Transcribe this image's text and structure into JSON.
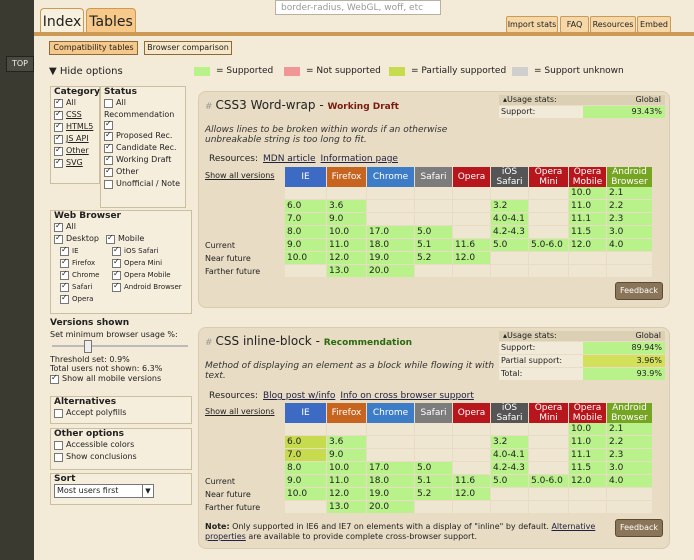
{
  "top_button": "TOP",
  "search": {
    "placeholder": "border-radius, WebGL, woff, etc"
  },
  "tabs": {
    "index": "Index",
    "tables": "Tables"
  },
  "top_nav": [
    "Import stats",
    "FAQ",
    "Resources",
    "Embed"
  ],
  "modes": {
    "compat": "Compatibility tables",
    "compare": "Browser comparison"
  },
  "hide_options": "Hide options",
  "legend": [
    {
      "label": "= Supported",
      "color": "#b9f28a"
    },
    {
      "label": "= Not supported",
      "color": "#f09696"
    },
    {
      "label": "= Partially supported",
      "color": "#c6dc4e"
    },
    {
      "label": "= Support unknown",
      "color": "#cfcfcf"
    }
  ],
  "sidebar": {
    "category_title": "Category",
    "categories": [
      {
        "label": "All",
        "checked": true,
        "link": false
      },
      {
        "label": "CSS",
        "checked": true,
        "link": true
      },
      {
        "label": "HTML5",
        "checked": true,
        "link": true
      },
      {
        "label": "JS API",
        "checked": true,
        "link": true
      },
      {
        "label": "Other",
        "checked": true,
        "link": true
      },
      {
        "label": "SVG",
        "checked": true,
        "link": true
      }
    ],
    "status_title": "Status",
    "statuses": [
      {
        "label": "All",
        "checked": false
      },
      {
        "label": "",
        "checked": true
      },
      {
        "label": "Proposed Rec.",
        "checked": true
      },
      {
        "label": "Candidate Rec.",
        "checked": true
      },
      {
        "label": "Working Draft",
        "checked": true
      },
      {
        "label": "Other",
        "checked": true
      },
      {
        "label": "Unofficial / Note",
        "checked": false
      }
    ],
    "status_extra": "Recommendation",
    "web_browser_title": "Web Browser",
    "wb_all": "All",
    "desktop": "Desktop",
    "mobile": "Mobile",
    "desktop_browsers": [
      "IE",
      "Firefox",
      "Chrome",
      "Safari",
      "Opera"
    ],
    "mobile_browsers": [
      "iOS Safari",
      "Opera Mini",
      "Opera Mobile",
      "Android Browser"
    ],
    "versions_title": "Versions shown",
    "min_usage_label": "Set minimum browser usage %:",
    "threshold": "Threshold set: 0.9%",
    "total_users": "Total users not shown: 6.3%",
    "show_mobile": "Show all mobile versions",
    "alternatives_title": "Alternatives",
    "accept_polyfills": "Accept polyfills",
    "other_title": "Other options",
    "accessible_colors": "Accessible colors",
    "show_conclusions": "Show conclusions",
    "sort_title": "Sort",
    "sort_value": "Most users first"
  },
  "browser_headers": [
    {
      "label": "IE",
      "color": "#3d6bc4"
    },
    {
      "label": "Firefox",
      "color": "#c7641f"
    },
    {
      "label": "Chrome",
      "color": "#3d7dc7"
    },
    {
      "label": "Safari",
      "color": "#7c7c7c"
    },
    {
      "label": "Opera",
      "color": "#b8161d"
    },
    {
      "label": "iOS Safari",
      "color": "#555"
    },
    {
      "label": "Opera Mini",
      "color": "#b8161d"
    },
    {
      "label": "Opera Mobile",
      "color": "#b8161d"
    },
    {
      "label": "Android Browser",
      "color": "#76a524"
    }
  ],
  "row_labels": {
    "current": "Current",
    "near": "Near future",
    "farther": "Farther future"
  },
  "show_all_versions": "Show all versions",
  "usage_stats": "Usage stats:",
  "global": "Global",
  "resources_label": "Resources:",
  "feedback": "Feedback",
  "features": [
    {
      "title": "CSS3 Word-wrap",
      "status": "Working Draft",
      "status_color": "#7a1a10",
      "description": "Allows lines to be broken within words if an otherwise unbreakable string is too long to fit.",
      "resources": [
        "MDN article",
        "Information page"
      ],
      "usage": [
        {
          "label": "Support:",
          "value": "93.43%"
        }
      ],
      "rows": [
        [
          "",
          "",
          "",
          "",
          "",
          "",
          "",
          "10.0",
          "2.1"
        ],
        [
          "6.0",
          "3.6",
          "",
          "",
          "",
          "3.2",
          "",
          "11.0",
          "2.2"
        ],
        [
          "7.0",
          "9.0",
          "",
          "",
          "",
          "4.0-4.1",
          "",
          "11.1",
          "2.3"
        ],
        [
          "8.0",
          "10.0",
          "17.0",
          "5.0",
          "",
          "4.2-4.3",
          "",
          "11.5",
          "3.0"
        ],
        [
          "9.0",
          "11.0",
          "18.0",
          "5.1",
          "11.6",
          "5.0",
          "5.0-6.0",
          "12.0",
          "4.0"
        ],
        [
          "10.0",
          "12.0",
          "19.0",
          "5.2",
          "12.0",
          "",
          "",
          "",
          ""
        ],
        [
          "",
          "13.0",
          "20.0",
          "",
          "",
          "",
          "",
          "",
          ""
        ]
      ]
    },
    {
      "title": "CSS inline-block",
      "status": "Recommendation",
      "status_color": "#2a6a10",
      "description": "Method of displaying an element as a block while flowing it with text.",
      "resources": [
        "Blog post w/info",
        "Info on cross browser support"
      ],
      "usage": [
        {
          "label": "Support:",
          "value": "89.94%"
        },
        {
          "label": "Partial support:",
          "value": "3.96%"
        },
        {
          "label": "Total:",
          "value": "93.9%"
        }
      ],
      "rows": [
        [
          "",
          "",
          "",
          "",
          "",
          "",
          "",
          "10.0",
          "2.1"
        ],
        [
          "6.0",
          "3.6",
          "",
          "",
          "",
          "3.2",
          "",
          "11.0",
          "2.2"
        ],
        [
          "7.0",
          "9.0",
          "",
          "",
          "",
          "4.0-4.1",
          "",
          "11.1",
          "2.3"
        ],
        [
          "8.0",
          "10.0",
          "17.0",
          "5.0",
          "",
          "4.2-4.3",
          "",
          "11.5",
          "3.0"
        ],
        [
          "9.0",
          "11.0",
          "18.0",
          "5.1",
          "11.6",
          "5.0",
          "5.0-6.0",
          "12.0",
          "4.0"
        ],
        [
          "10.0",
          "12.0",
          "19.0",
          "5.2",
          "12.0",
          "",
          "",
          "",
          ""
        ],
        [
          "",
          "13.0",
          "20.0",
          "",
          "",
          "",
          "",
          "",
          ""
        ]
      ],
      "partial_cells": [
        [
          1,
          0
        ],
        [
          2,
          0
        ]
      ],
      "note_bold": "Note:",
      "note_text": " Only supported in IE6 and IE7 on elements with a display of \"inline\" by default. ",
      "note_link": "Alternative properties",
      "note_tail": " are available to provide complete cross-browser support."
    }
  ]
}
